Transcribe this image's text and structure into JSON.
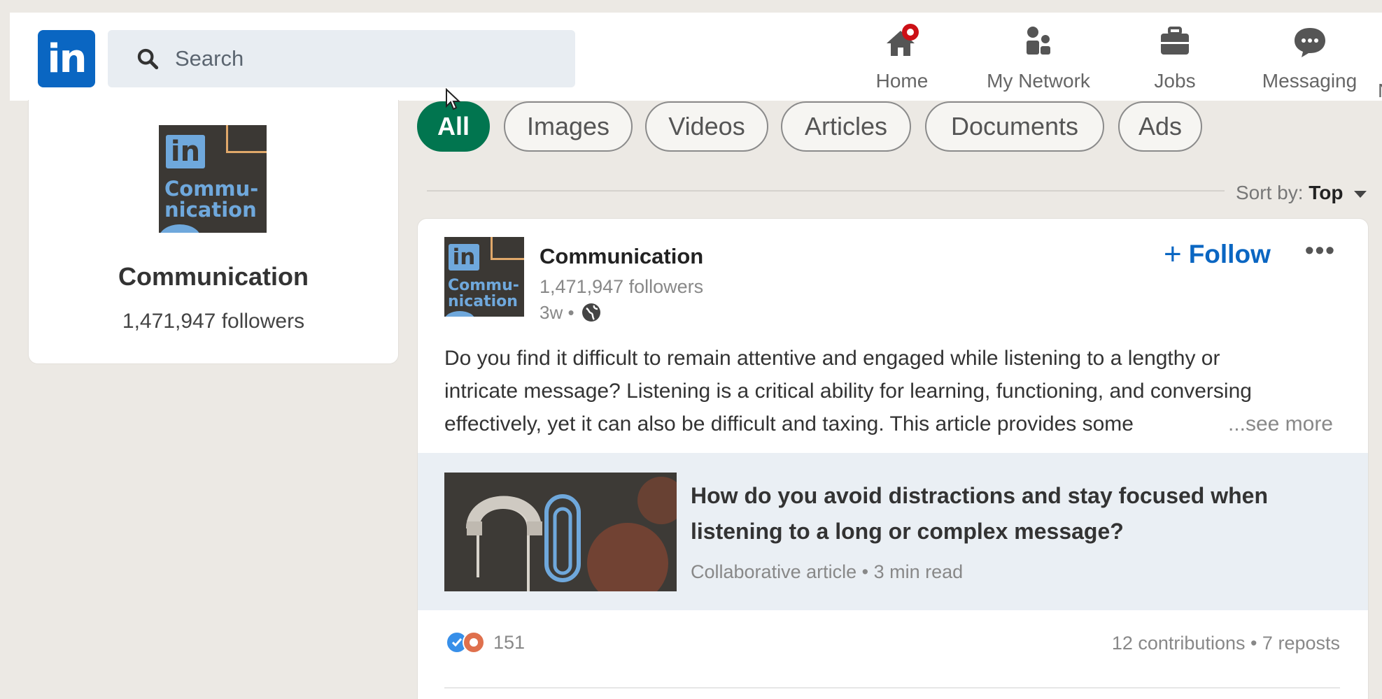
{
  "nav": {
    "logo": "in",
    "search_placeholder": "Search",
    "items": [
      {
        "label": "Home",
        "icon": "home-icon"
      },
      {
        "label": "My Network",
        "icon": "network-icon"
      },
      {
        "label": "Jobs",
        "icon": "jobs-icon"
      },
      {
        "label": "Messaging",
        "icon": "messaging-icon"
      }
    ],
    "cut_item_label": "N"
  },
  "left_card": {
    "logo_in": "in",
    "logo_text_1": "Commu-",
    "logo_text_2": "nication",
    "name": "Communication",
    "followers": "1,471,947 followers"
  },
  "filters": [
    "All",
    "Images",
    "Videos",
    "Articles",
    "Documents",
    "Ads"
  ],
  "active_filter": "All",
  "sort": {
    "label": "Sort by:",
    "value": "Top"
  },
  "post": {
    "logo_in": "in",
    "logo_text_1": "Commu-",
    "logo_text_2": "nication",
    "author": "Communication",
    "followers": "1,471,947 followers",
    "time": "3w •",
    "follow_label": "Follow",
    "more_label": "•••",
    "text_lines": [
      "Do you find it difficult to remain attentive and engaged while listening to a lengthy or",
      "intricate message? Listening is a critical ability for learning, functioning, and conversing",
      "effectively, yet it can also be difficult and taxing. This article provides some"
    ],
    "see_more": "...see more",
    "article": {
      "title_lines": [
        "How do you avoid distractions and stay focused when",
        "listening to a long or complex message?"
      ],
      "subtitle": "Collaborative article • 3 min read"
    },
    "reaction_count": "151",
    "stats": "12 contributions • 7 reposts"
  },
  "colors": {
    "brand_blue": "#0a66c2",
    "active_filter_green": "#01754f",
    "notification_red": "#cc1016"
  }
}
